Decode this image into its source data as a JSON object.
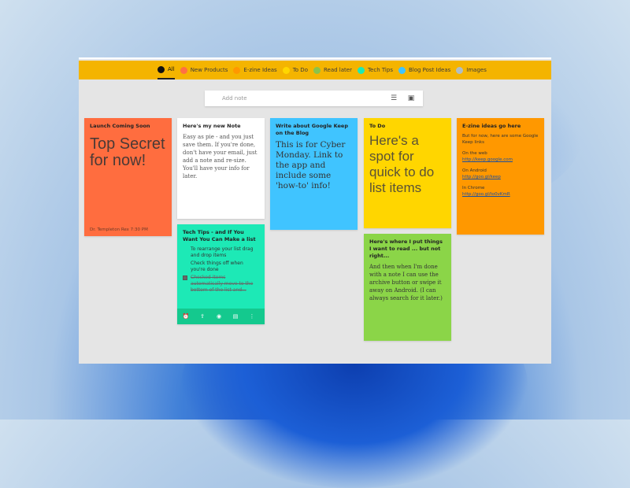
{
  "tabs": [
    {
      "label": "All",
      "color": "#111111",
      "active": true
    },
    {
      "label": "New Products",
      "color": "#ff7043"
    },
    {
      "label": "E-zine Ideas",
      "color": "#ff9800"
    },
    {
      "label": "To Do",
      "color": "#ffd600"
    },
    {
      "label": "Read later",
      "color": "#8bc34a"
    },
    {
      "label": "Tech Tips",
      "color": "#1de9b6"
    },
    {
      "label": "Blog Post Ideas",
      "color": "#40c4ff"
    },
    {
      "label": "Images",
      "color": "#b0bec5"
    }
  ],
  "search": {
    "placeholder": "Add note",
    "list_icon": "list-icon",
    "image_icon": "image-icon"
  },
  "notes": {
    "launch": {
      "title": "Launch Coming Soon",
      "body": "Top Secret for now!",
      "footer": "Dr. Templeton Rex 7:30 PM",
      "color": "#ff6d3f"
    },
    "newnote": {
      "title": "Here's my new Note",
      "body": "Easy as pie - and you just save them. If you're done, don't have your email, just add a note and re-size. You'll have your info for later.",
      "color": "#ffffff"
    },
    "tech": {
      "title": "Tech Tips - and If You Want You Can Make a list",
      "items": [
        {
          "text": "To rearrange your list drag and drop items",
          "checked": false
        },
        {
          "text": "Check things off when you're done",
          "checked": false
        },
        {
          "text": "Checked items automatically move to the bottom of the list and...",
          "checked": true
        }
      ],
      "color": "#1de9b6"
    },
    "google": {
      "title": "Write about Google Keep on the Blog",
      "body": "This is for Cyber Monday. Link to the app and include some 'how-to' info!",
      "color": "#40c4ff"
    },
    "todo": {
      "title": "To Do",
      "body": "Here's a spot for quick to do list items",
      "color": "#ffd600"
    },
    "read": {
      "title": "Here's where I put things I want to read ... but not right...",
      "body": "And then when I'm done with a note I can use the archive button or swipe it away on Android. (I can always search for it later.)",
      "color": "#8bd548"
    },
    "ezine": {
      "title": "E-zine ideas go here",
      "intro": "But for now, here are some Google Keep links",
      "web_label": "On the web",
      "web_link": "http://keep.google.com",
      "android_label": "On Android",
      "android_link": "http://goo.gl/keep",
      "chrome_label": "In Chrome",
      "chrome_link": "http://goo.gl/to0vKmR"
    }
  }
}
